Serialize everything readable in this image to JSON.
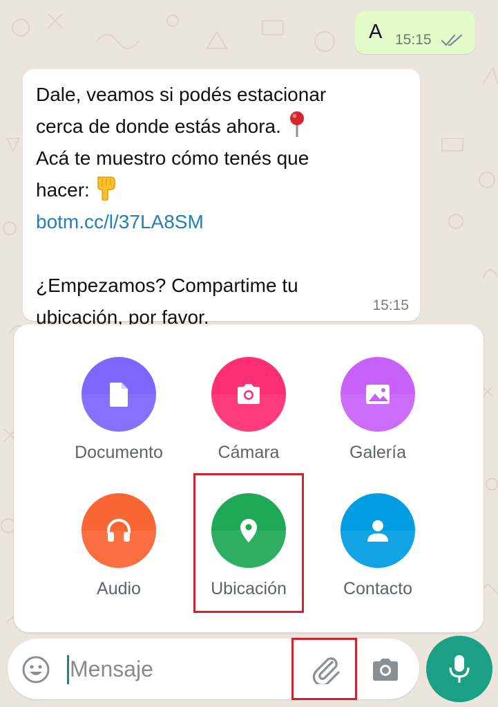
{
  "chat": {
    "outgoing": {
      "text": "A",
      "time": "15:15",
      "status_icon": "double-check-icon"
    },
    "incoming": {
      "lines": [
        "Dale, veamos si podés estacionar",
        "cerca de donde estás ahora.",
        "Acá te muestro cómo tenés que",
        "hacer:",
        "botm.cc/l/37LA8SM",
        "",
        "¿Empezamos? Compartime tu",
        "ubicación, por favor."
      ],
      "time": "15:15",
      "emoji_1": "round-pushpin-emoji",
      "emoji_2": "pointing-down-emoji"
    }
  },
  "attach_menu": {
    "items": [
      {
        "label": "Documento",
        "icon": "document-icon",
        "color": "#7f66ff"
      },
      {
        "label": "Cámara",
        "icon": "camera-icon",
        "color": "#fe2e74"
      },
      {
        "label": "Galería",
        "icon": "gallery-icon",
        "color": "#c861fa"
      },
      {
        "label": "Audio",
        "icon": "headphones-icon",
        "color": "#f96533"
      },
      {
        "label": "Ubicación",
        "icon": "location-pin-icon",
        "color": "#1fa855"
      },
      {
        "label": "Contacto",
        "icon": "contact-icon",
        "color": "#009de2"
      }
    ]
  },
  "input_bar": {
    "placeholder": "Mensaje",
    "emoji_icon": "emoji-icon",
    "attach_icon": "paperclip-icon",
    "camera_icon": "camera-icon",
    "mic_icon": "microphone-icon"
  },
  "colors": {
    "wallpaper": "#ece5dd",
    "outgoing_bubble": "#e2fbc9",
    "link": "#1f7ebd",
    "accent": "#1ba085",
    "highlight": "#d2202f"
  }
}
